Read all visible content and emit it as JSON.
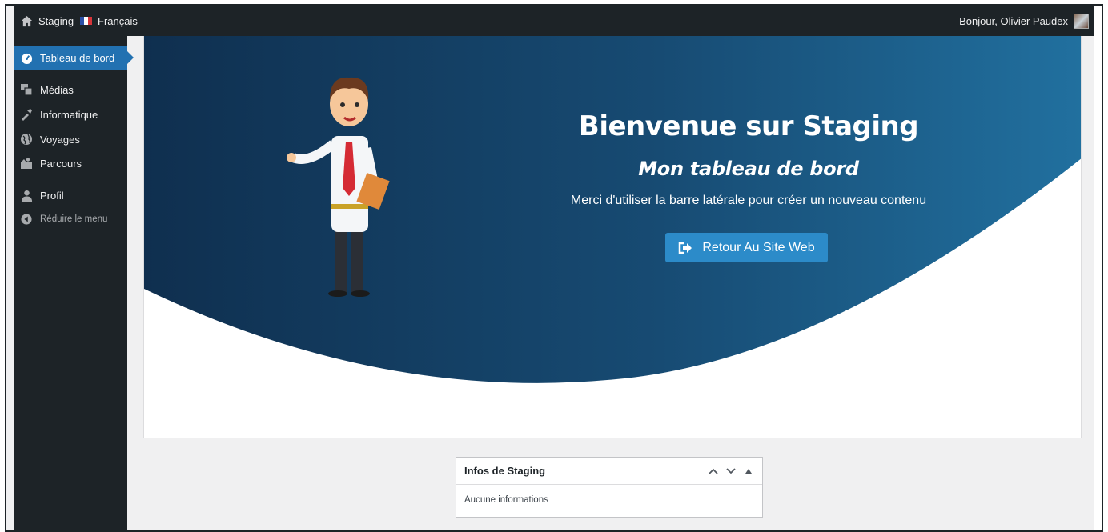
{
  "adminbar": {
    "site_name": "Staging",
    "language": "Français",
    "greeting": "Bonjour, Olivier Paudex"
  },
  "sidebar": {
    "items": [
      {
        "label": "Tableau de bord",
        "icon": "dashboard-icon",
        "active": true
      },
      {
        "label": "Médias",
        "icon": "media-icon"
      },
      {
        "label": "Informatique",
        "icon": "tools-icon"
      },
      {
        "label": "Voyages",
        "icon": "globe-icon"
      },
      {
        "label": "Parcours",
        "icon": "hiking-icon"
      },
      {
        "label": "Profil",
        "icon": "user-icon"
      },
      {
        "label": "Réduire le menu",
        "icon": "collapse-icon"
      }
    ]
  },
  "hero": {
    "title": "Bienvenue sur Staging",
    "subtitle": "Mon tableau de bord",
    "text": "Merci d'utiliser la barre latérale pour créer un nouveau contenu",
    "button_label": "Retour Au Site Web"
  },
  "widget": {
    "title": "Infos de Staging",
    "body": "Aucune informations"
  },
  "colors": {
    "admin_dark": "#1d2327",
    "accent": "#2271b1",
    "hero_dark": "#0f2f4f",
    "hero_light": "#21709f",
    "button": "#2c8bc9"
  }
}
